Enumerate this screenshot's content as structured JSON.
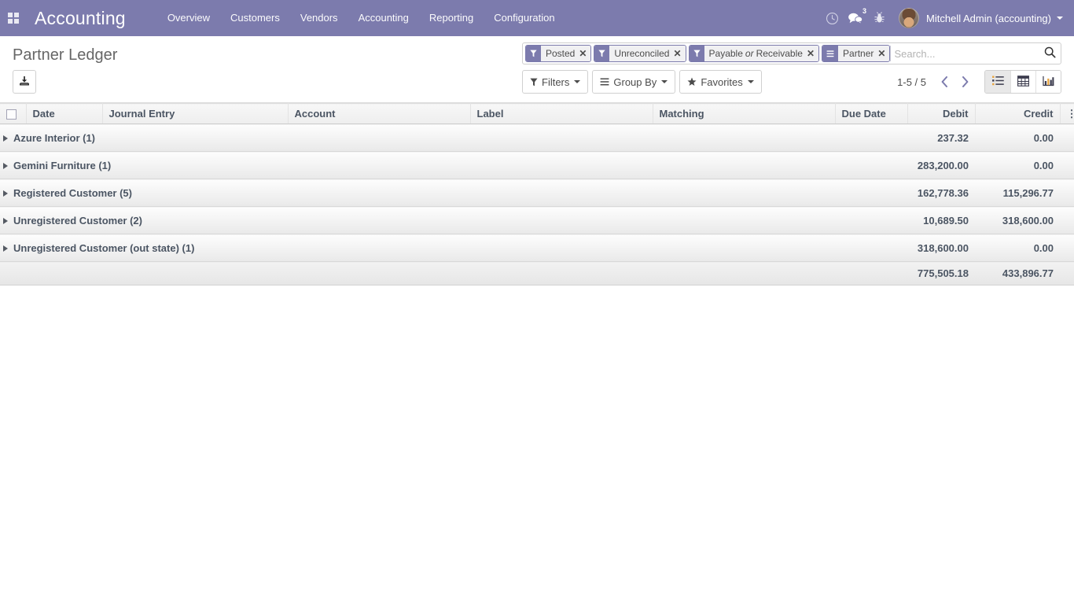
{
  "navbar": {
    "apps_icon": "apps-grid-icon",
    "brand": "Accounting",
    "menu": [
      {
        "label": "Overview"
      },
      {
        "label": "Customers"
      },
      {
        "label": "Vendors"
      },
      {
        "label": "Accounting"
      },
      {
        "label": "Reporting"
      },
      {
        "label": "Configuration"
      }
    ],
    "activity_icon": "clock-icon",
    "messages_icon": "messages-icon",
    "messages_count": "3",
    "debug_icon": "bug-icon",
    "user_name": "Mitchell Admin (accounting)",
    "accent_color": "#7c7bad"
  },
  "control_panel": {
    "title": "Partner Ledger",
    "export_icon": "download-icon",
    "buttons": [
      {
        "label": "Filters",
        "icon": "filter-icon"
      },
      {
        "label": "Group By",
        "icon": "bars-icon"
      },
      {
        "label": "Favorites",
        "icon": "star-icon"
      }
    ],
    "pager": "1-5 / 5",
    "prev_icon": "chevron-left-icon",
    "next_icon": "chevron-right-icon",
    "views": [
      {
        "name": "list",
        "icon": "list-view-icon",
        "active": true
      },
      {
        "name": "pivot",
        "icon": "pivot-view-icon",
        "active": false
      },
      {
        "name": "graph",
        "icon": "graph-view-icon",
        "active": false
      }
    ]
  },
  "search": {
    "placeholder": "Search...",
    "value": "",
    "search_icon": "magnifier-icon",
    "facets": [
      {
        "label": "Posted",
        "icon": "filter-icon",
        "remove": "✕"
      },
      {
        "label": "Unreconciled",
        "icon": "filter-icon",
        "remove": "✕"
      },
      {
        "label_pre": "Payable",
        "label_em": "or",
        "label_post": "Receivable",
        "icon": "filter-icon",
        "remove": "✕"
      },
      {
        "label": "Partner",
        "icon": "bars-icon",
        "remove": "✕"
      }
    ]
  },
  "table": {
    "columns": [
      {
        "label": "Date",
        "align": "left"
      },
      {
        "label": "Journal Entry",
        "align": "left"
      },
      {
        "label": "Account",
        "align": "left"
      },
      {
        "label": "Label",
        "align": "left"
      },
      {
        "label": "Matching",
        "align": "left"
      },
      {
        "label": "Due Date",
        "align": "left"
      },
      {
        "label": "Debit",
        "align": "right"
      },
      {
        "label": "Credit",
        "align": "right"
      }
    ],
    "options_icon": "vertical-dots-icon",
    "select_all_icon": "checkbox-unchecked-icon",
    "groups": [
      {
        "name": "Azure Interior (1)",
        "debit": "237.32",
        "credit": "0.00"
      },
      {
        "name": "Gemini Furniture (1)",
        "debit": "283,200.00",
        "credit": "0.00"
      },
      {
        "name": "Registered Customer (5)",
        "debit": "162,778.36",
        "credit": "115,296.77"
      },
      {
        "name": "Unregistered Customer (2)",
        "debit": "10,689.50",
        "credit": "318,600.00"
      },
      {
        "name": "Unregistered Customer (out state) (1)",
        "debit": "318,600.00",
        "credit": "0.00"
      }
    ],
    "total": {
      "label": "",
      "debit": "775,505.18",
      "credit": "433,896.77"
    }
  }
}
